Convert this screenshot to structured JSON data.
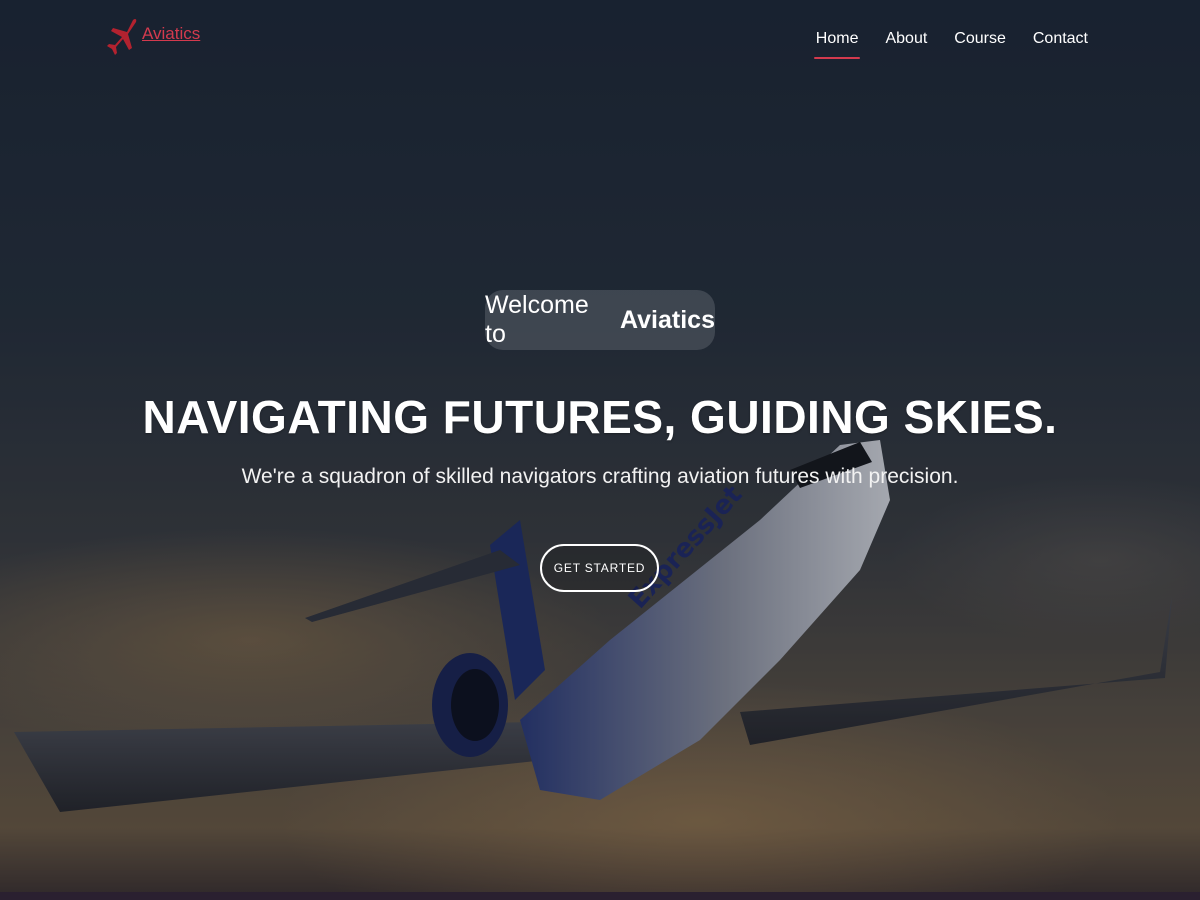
{
  "brand": {
    "name": "Aviatics",
    "accent_color": "#d33a4e",
    "icon": "airplane-icon"
  },
  "nav": {
    "items": [
      {
        "label": "Home",
        "active": true
      },
      {
        "label": "About",
        "active": false
      },
      {
        "label": "Course",
        "active": false
      },
      {
        "label": "Contact",
        "active": false
      }
    ]
  },
  "hero": {
    "welcome_prefix": "Welcome to",
    "welcome_brand": "Aviatics",
    "headline": "NAVIGATING FUTURES, GUIDING SKIES.",
    "subheadline": "We're a squadron of skilled navigators crafting aviation futures with precision.",
    "cta_label": "GET STARTED",
    "background_image": "jet-airliner-in-flight-at-sunset"
  }
}
